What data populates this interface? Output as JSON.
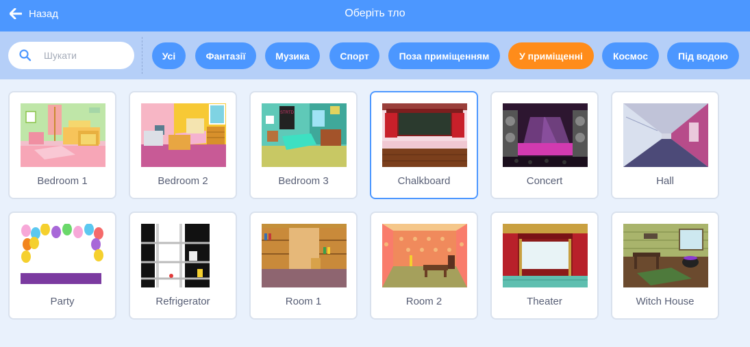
{
  "header": {
    "back_label": "Назад",
    "title": "Оберіть тло"
  },
  "search": {
    "placeholder": "Шукати",
    "value": ""
  },
  "tags": [
    "Усі",
    "Фантазії",
    "Музика",
    "Спорт",
    "Поза приміщенням",
    "У приміщенні",
    "Космос",
    "Під водою"
  ],
  "active_tag": "У приміщенні",
  "selected_backdrop": "Chalkboard",
  "backdrops": [
    {
      "name": "Bedroom 1"
    },
    {
      "name": "Bedroom 2"
    },
    {
      "name": "Bedroom 3"
    },
    {
      "name": "Chalkboard"
    },
    {
      "name": "Concert"
    },
    {
      "name": "Hall"
    },
    {
      "name": "Party"
    },
    {
      "name": "Refrigerator"
    },
    {
      "name": "Room 1"
    },
    {
      "name": "Room 2"
    },
    {
      "name": "Theater"
    },
    {
      "name": "Witch House"
    }
  ],
  "colors": {
    "header": "#4c97ff",
    "filter_bar": "#b5cff8",
    "tag": "#4c97ff",
    "active_tag": "#ff8c1a",
    "background": "#e9f1fc"
  }
}
